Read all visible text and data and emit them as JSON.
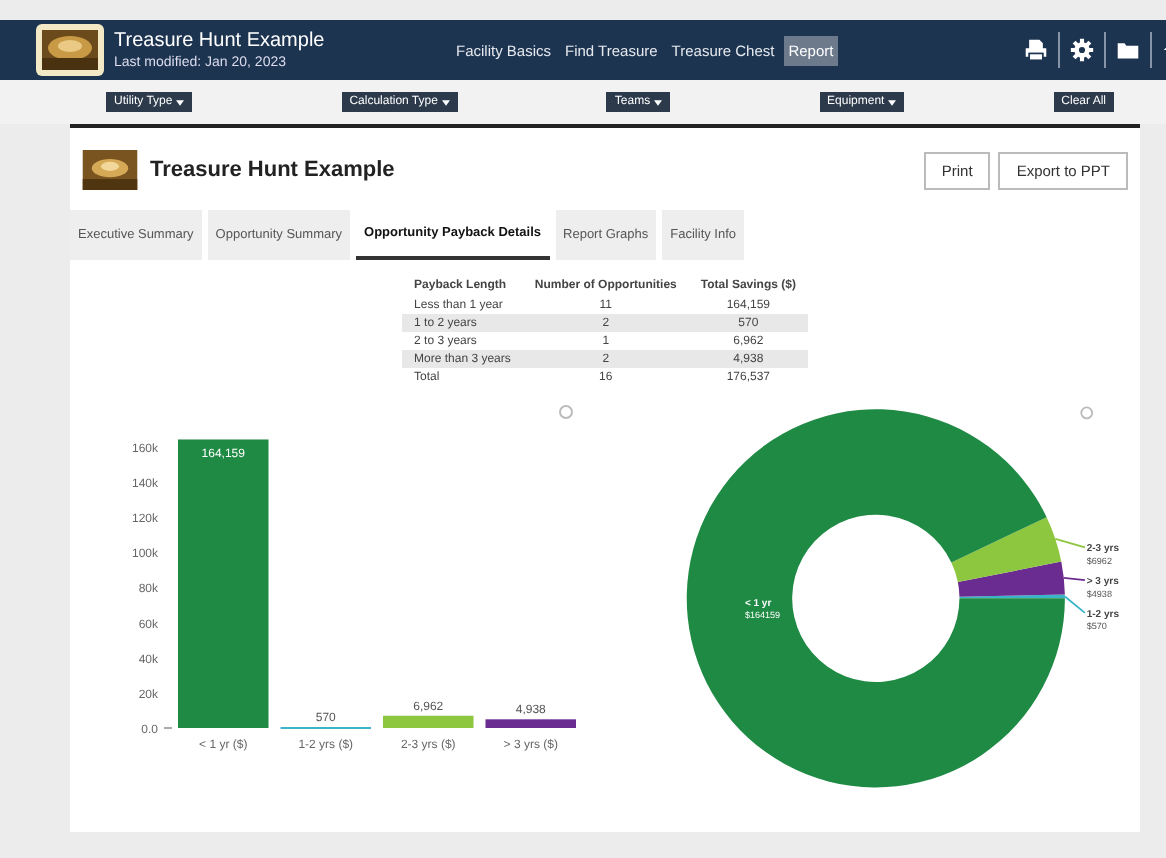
{
  "app_bar": {
    "title": "Treasure Hunt Example",
    "subtitle": "Last modified: Jan 20, 2023",
    "nav": [
      {
        "label": "Facility Basics",
        "selected": false
      },
      {
        "label": "Find Treasure",
        "selected": false
      },
      {
        "label": "Treasure Chest",
        "selected": false
      },
      {
        "label": "Report",
        "selected": true
      }
    ]
  },
  "filters": [
    {
      "label": "Utility Type",
      "kind": "dropdown"
    },
    {
      "label": "Calculation Type",
      "kind": "dropdown"
    },
    {
      "label": "Teams",
      "kind": "dropdown"
    },
    {
      "label": "Equipment",
      "kind": "dropdown"
    },
    {
      "label": "Clear All",
      "kind": "button"
    }
  ],
  "report": {
    "title": "Treasure Hunt Example",
    "buttons": [
      "Print",
      "Export to PPT"
    ],
    "tabs": [
      {
        "label": "Executive Summary",
        "selected": false
      },
      {
        "label": "Opportunity Summary",
        "selected": false
      },
      {
        "label": "Opportunity Payback Details",
        "selected": true
      },
      {
        "label": "Report Graphs",
        "selected": false
      },
      {
        "label": "Facility Info",
        "selected": false
      }
    ],
    "table": {
      "columns": [
        "Payback Length",
        "Number of Opportunities",
        "Total Savings ($)"
      ],
      "rows": [
        [
          "Less than 1 year",
          "11",
          "164,159"
        ],
        [
          "1 to 2 years",
          "2",
          "570"
        ],
        [
          "2 to 3 years",
          "1",
          "6,962"
        ],
        [
          "More than 3 years",
          "2",
          "4,938"
        ],
        [
          "Total",
          "16",
          "176,537"
        ]
      ]
    },
    "bar_chart": {
      "chart_data": {
        "type": "bar",
        "categories": [
          "< 1 yr ($)",
          "1-2 yrs ($)",
          "2-3 yrs ($)",
          "> 3 yrs ($)"
        ],
        "values": [
          164159,
          570,
          6962,
          4938
        ],
        "colors": [
          "#1e8a44",
          "#3ab5c8",
          "#8dc63f",
          "#6a2c91"
        ],
        "value_labels": [
          "164,159",
          "570",
          "6,962",
          "4,938"
        ],
        "ylim": [
          0,
          165000
        ],
        "yticks": [
          {
            "value": 0,
            "label": "0.0"
          },
          {
            "value": 20000,
            "label": "20k"
          },
          {
            "value": 40000,
            "label": "40k"
          },
          {
            "value": 60000,
            "label": "60k"
          },
          {
            "value": 80000,
            "label": "80k"
          },
          {
            "value": 100000,
            "label": "100k"
          },
          {
            "value": 120000,
            "label": "120k"
          },
          {
            "value": 140000,
            "label": "140k"
          },
          {
            "value": 160000,
            "label": "160k"
          }
        ]
      }
    },
    "donut_chart": {
      "chart_data": {
        "type": "donut",
        "categories": [
          "1-2 yrs",
          "> 3 yrs",
          "2-3 yrs",
          "< 1 yr"
        ],
        "values": [
          570,
          4938,
          6962,
          164159
        ],
        "colors": [
          "#3ab5c8",
          "#6a2c91",
          "#8dc63f",
          "#1e8a44"
        ],
        "value_labels": [
          "$570",
          "$4938",
          "$6962",
          "$164159"
        ]
      }
    }
  }
}
